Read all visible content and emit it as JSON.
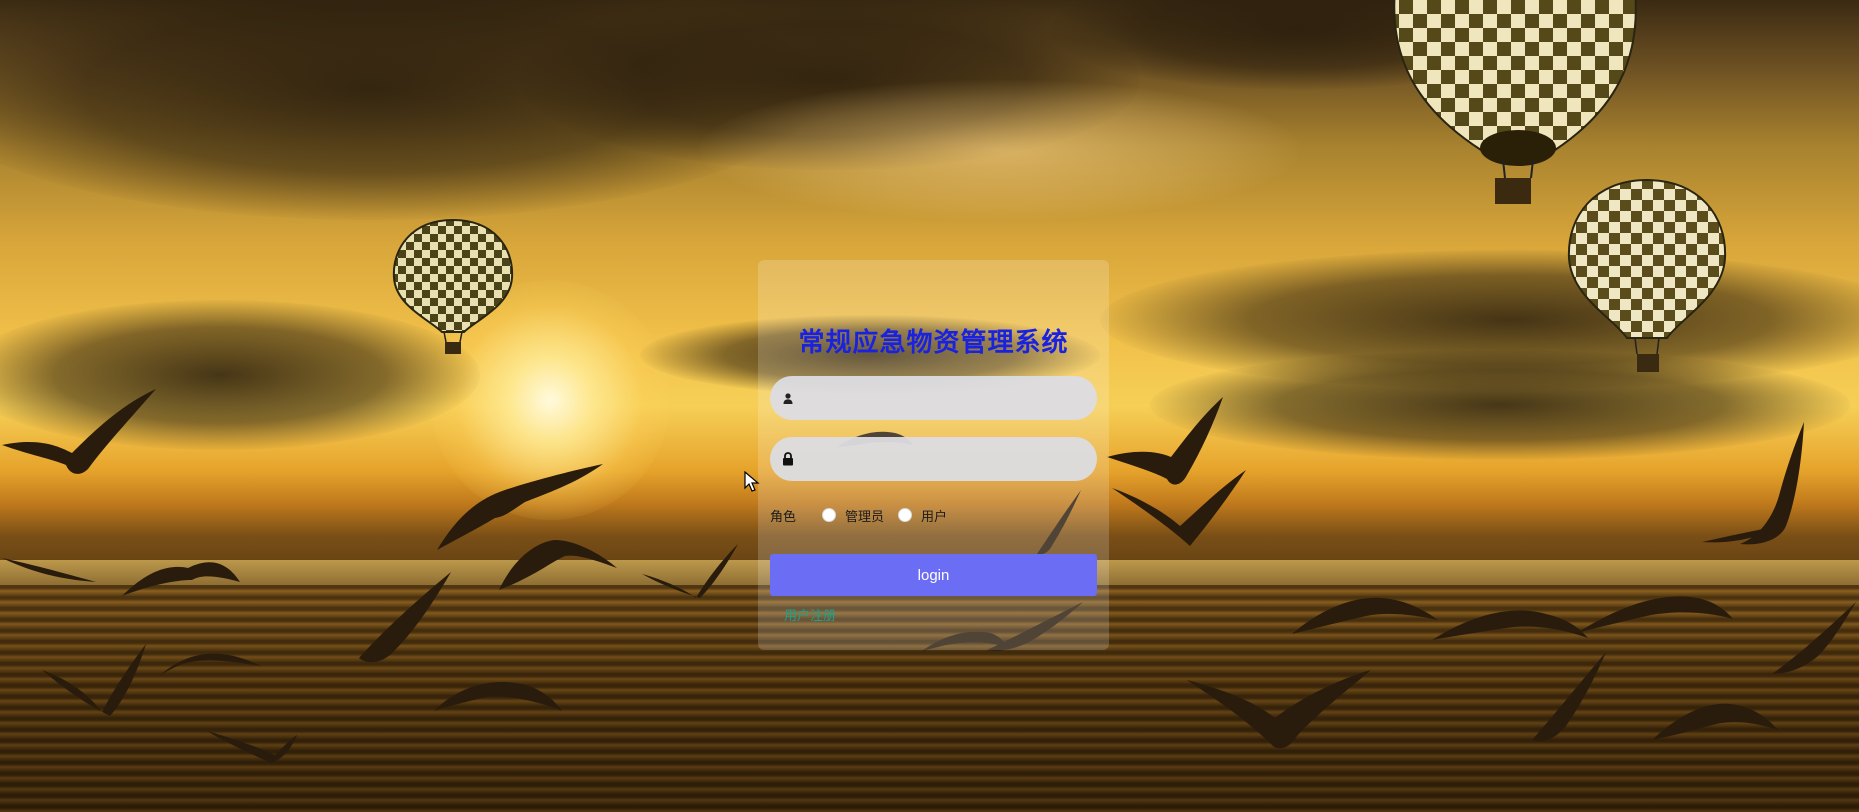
{
  "login": {
    "title": "常规应急物资管理系统",
    "username_placeholder": "",
    "password_placeholder": "",
    "role_label": "角色",
    "roles": [
      {
        "label": "管理员",
        "selected": false
      },
      {
        "label": "用户",
        "selected": false
      }
    ],
    "submit_label": "login",
    "register_link": "用户注册"
  },
  "icons": {
    "username": "user-icon",
    "password": "lock-icon"
  },
  "colors": {
    "title": "#1a22e0",
    "button": "#6b6df5",
    "register_link": "#1aa38a"
  }
}
